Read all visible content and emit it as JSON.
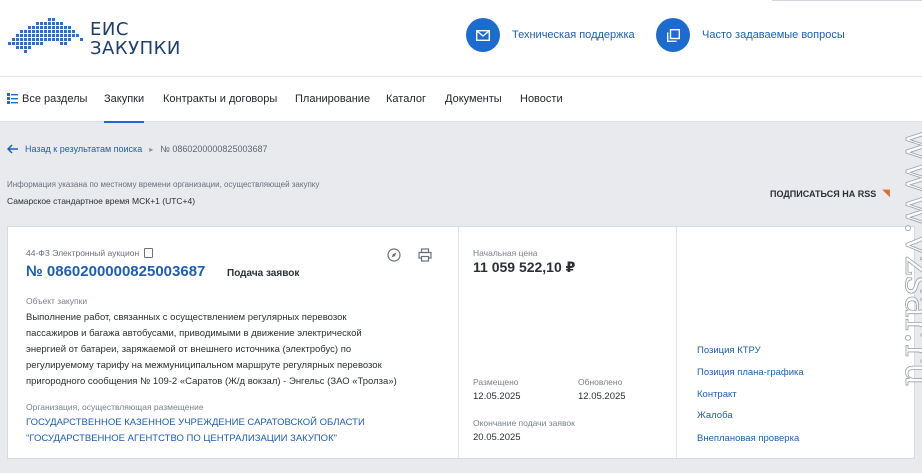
{
  "header": {
    "logo_line1": "ЕИС",
    "logo_line2": "ЗАКУПКИ",
    "support_label": "Техническая поддержка",
    "faq_label": "Часто задаваемые вопросы"
  },
  "nav": {
    "items": [
      "Все разделы",
      "Закупки",
      "Контракты и договоры",
      "Планирование",
      "Каталог",
      "Документы",
      "Новости"
    ],
    "active": "Закупки"
  },
  "breadcrumb": {
    "back_label": "Назад к результатам поиска",
    "current": "№ 0860200000825003687"
  },
  "timezone": {
    "note": "Информация указана по местному времени организации, осуществляющей закупку",
    "value": "Самарское стандартное время МСК+1 (UTC+4)"
  },
  "rss": {
    "label": "ПОДПИСАТЬСЯ НА RSS"
  },
  "purchase": {
    "law": "44-ФЗ Электронный аукцион",
    "number": "№ 0860200000825003687",
    "stage": "Подача заявок",
    "object_label": "Объект закупки",
    "object_lines": [
      "Выполнение работ, связанных с осуществлением регулярных перевозок",
      "пассажиров и багажа автобусами, приводимыми в движение электрической",
      "энергией от батареи, заряжаемой от внешнего источника (электробус) по",
      "регулируемому тарифу на межмуниципальном маршруте регулярных перевозок",
      "пригородного сообщения № 109-2 «Саратов (Ж/д вокзал) - Энгельс (ЗАО «Тролза»)"
    ],
    "org_label": "Организация, осуществляющая размещение",
    "org_lines": [
      "ГОСУДАРСТВЕННОЕ КАЗЕННОЕ УЧРЕЖДЕНИЕ САРАТОВСКОЙ ОБЛАСТИ",
      "\"ГОСУДАРСТВЕННОЕ АГЕНТСТВО ПО ЦЕНТРАЛИЗАЦИИ ЗАКУПОК\""
    ],
    "price_label": "Начальная цена",
    "price": "11 059 522,10 ₽",
    "placed_label": "Размещено",
    "placed": "12.05.2025",
    "updated_label": "Обновлено",
    "updated": "12.05.2025",
    "deadline_label": "Окончание подачи заявок",
    "deadline": "20.05.2025"
  },
  "side_links": [
    "Позиция КТРУ",
    "Позиция плана-графика",
    "Контракт",
    "Жалоба",
    "Внеплановая проверка"
  ],
  "watermark": "www.vzsar.ru",
  "colors": {
    "accent": "#1c6ccf",
    "link": "#1d5eb3",
    "rss": "#e36a2d"
  }
}
